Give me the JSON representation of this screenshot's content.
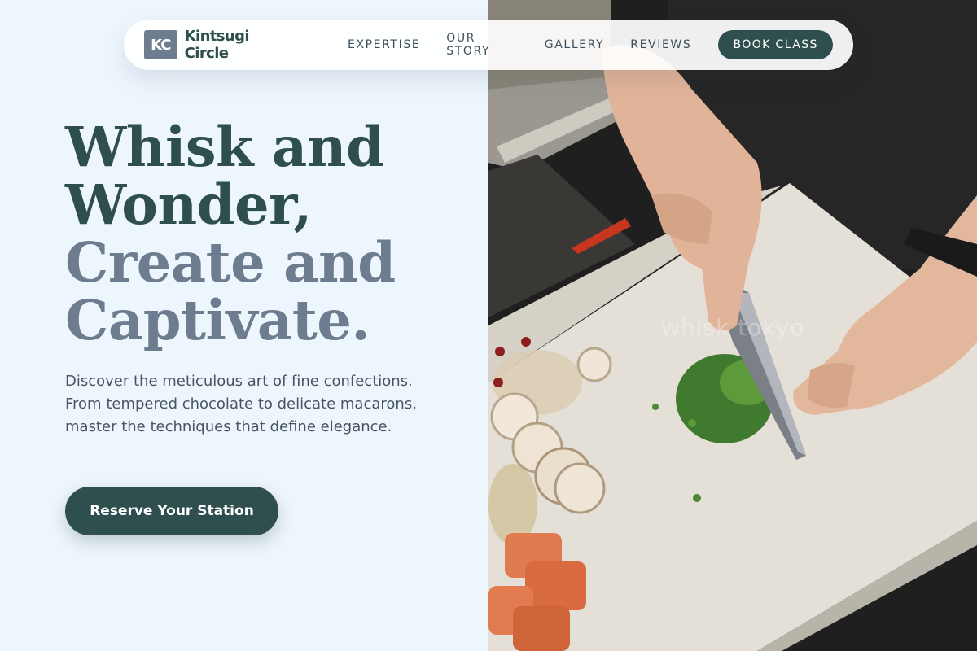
{
  "nav": {
    "logo_mark": "KC",
    "brand": "Kintsugi Circle",
    "links": [
      "EXPERTISE",
      "OUR STORY",
      "GALLERY",
      "REVIEWS"
    ],
    "cta": "BOOK CLASS"
  },
  "hero": {
    "headline_line1": "Whisk and",
    "headline_line2": "Wonder,",
    "headline_line3": "Create and",
    "headline_line4": "Captivate.",
    "lede": "Discover the meticulous art of fine confections. From tempered chocolate to delicate macarons, master the techniques that define elegance.",
    "cta": "Reserve Your Station"
  },
  "photo": {
    "watermark": "whisk tokyo"
  },
  "colors": {
    "page_bg": "#eef6fd",
    "primary": "#2f4f4e",
    "muted_slate": "#6d7d8f",
    "body_text": "#4a5563"
  }
}
